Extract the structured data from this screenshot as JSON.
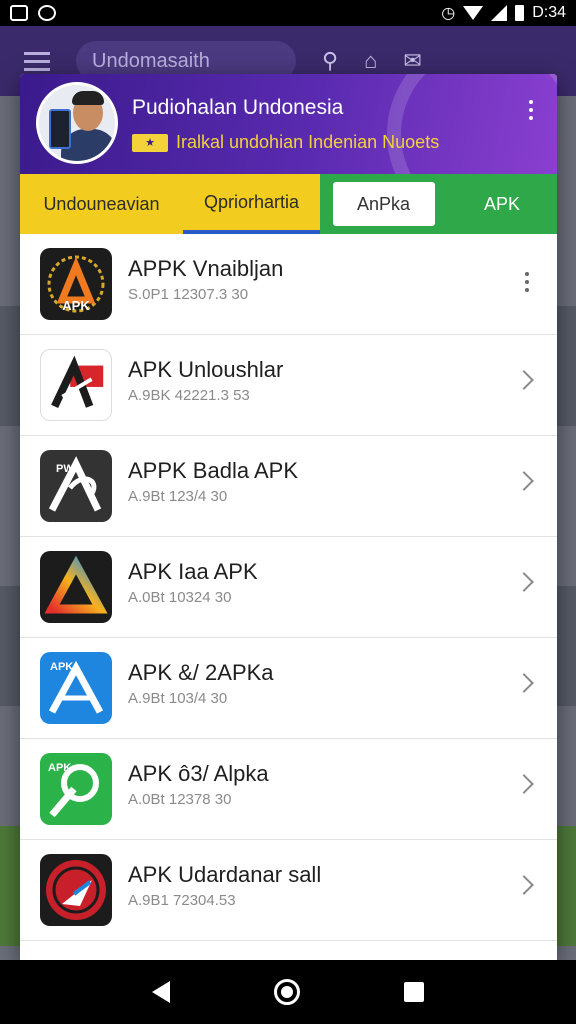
{
  "status_bar": {
    "time": "D:34"
  },
  "background": {
    "search_text": "Undomasaith"
  },
  "dialog": {
    "title": "Pudiohalan Undonesia",
    "subtitle": "Iralkal undohian Indenian Nuoets",
    "tabs": [
      {
        "label": "Undouneavian"
      },
      {
        "label": "Qpriorhartia"
      },
      {
        "label": "AnPka"
      },
      {
        "label": "APK"
      }
    ],
    "apps": [
      {
        "title": "APPK Vnaibljan",
        "meta": "S.0P1 12307.3 30",
        "icon": "apk-laurel-icon",
        "accent": "#1c1c1c"
      },
      {
        "title": "APK Unloushlar",
        "meta": "A.9BK 42221.3 53",
        "icon": "apk-red-a-icon",
        "accent": "#d6262b"
      },
      {
        "title": "APPK Badla APK",
        "meta": "A.9Bt 123/4 30",
        "icon": "apk-white-a-icon",
        "accent": "#333333"
      },
      {
        "title": "APK Iaa APK",
        "meta": "A.0Bt 10324 30",
        "icon": "apk-gradient-a-icon",
        "accent": "#1c1c1c"
      },
      {
        "title": "APK &/ 2APKa",
        "meta": "A.9Bt 103/4 30",
        "icon": "apk-blue-a-icon",
        "accent": "#1f86e0"
      },
      {
        "title": "APK ô3/ Alpka",
        "meta": "A.0Bt 12378 30",
        "icon": "apk-green-a-icon",
        "accent": "#2bb34a"
      },
      {
        "title": "APK Udardanar sall",
        "meta": "A.9B1 72304.53",
        "icon": "apk-red-badge-icon",
        "accent": "#c8202a"
      }
    ]
  }
}
